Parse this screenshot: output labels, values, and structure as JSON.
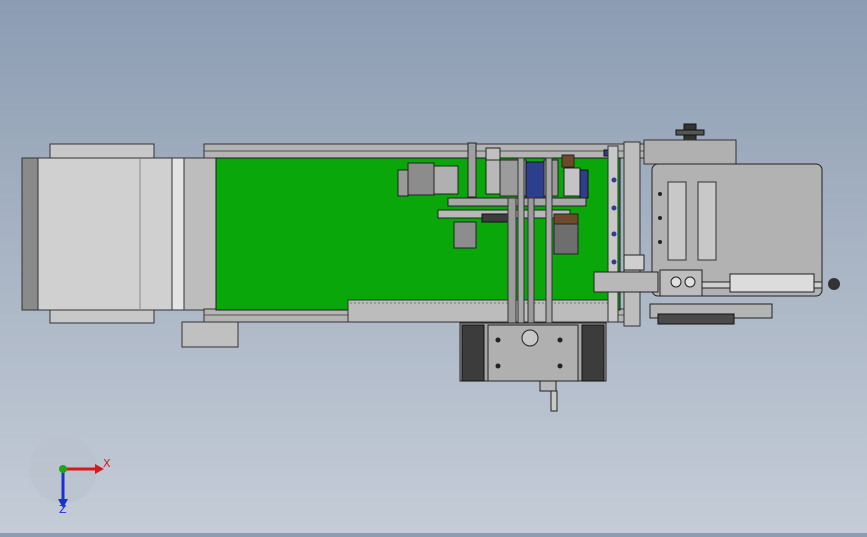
{
  "window": {
    "background_top": "#8c9cb3",
    "background_bottom": "#c4ccd7"
  },
  "model": {
    "conveyor_belt_color": "#0aa70a",
    "frame_color": "#c8c8c8",
    "metal_color": "#9a9a9a",
    "dark_metal_color": "#4a4a4a",
    "motor_blue": "#2d3f8c",
    "motor_brown": "#6e4a2a"
  },
  "triad": {
    "x_label": "X",
    "z_label": "Z",
    "x_color": "#d21c1c",
    "y_color": "#1ba61b",
    "z_color": "#1c2fd2"
  }
}
